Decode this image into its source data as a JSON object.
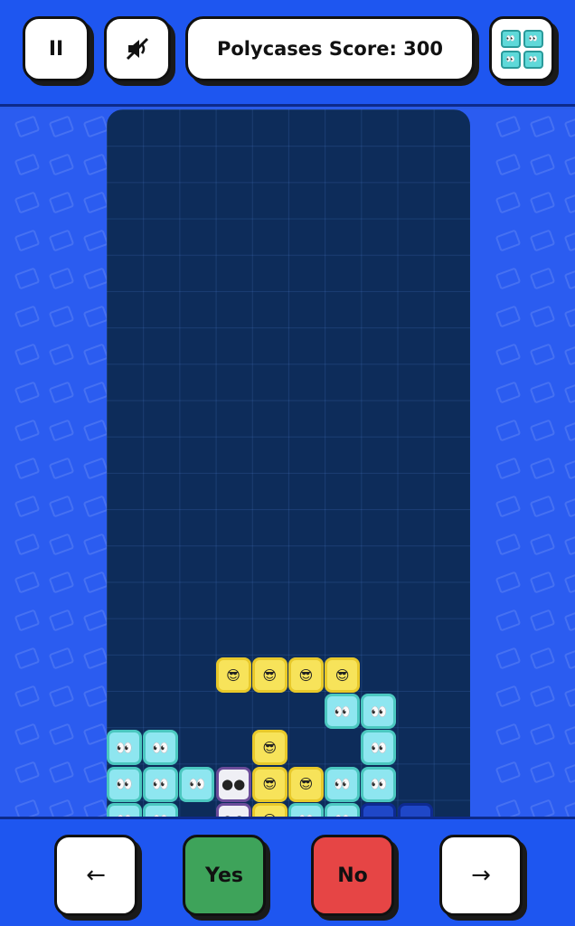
{
  "header": {
    "pause_label": "II",
    "score_text": "Polycases Score: 300",
    "menu_preview_glyph": "👀"
  },
  "board": {
    "columns": 10,
    "rows_visible": 20,
    "blocks": [
      {
        "col": 3,
        "row": 15,
        "color": "yellow",
        "face": "😎"
      },
      {
        "col": 4,
        "row": 15,
        "color": "yellow",
        "face": "😎"
      },
      {
        "col": 5,
        "row": 15,
        "color": "yellow",
        "face": "😎"
      },
      {
        "col": 6,
        "row": 15,
        "color": "yellow",
        "face": "😎"
      },
      {
        "col": 6,
        "row": 16,
        "color": "cyan",
        "face": "👀"
      },
      {
        "col": 7,
        "row": 16,
        "color": "cyan",
        "face": "👀"
      },
      {
        "col": 0,
        "row": 17,
        "color": "cyan",
        "face": "👀"
      },
      {
        "col": 1,
        "row": 17,
        "color": "cyan",
        "face": "👀"
      },
      {
        "col": 4,
        "row": 17,
        "color": "yellow",
        "face": "😎"
      },
      {
        "col": 7,
        "row": 17,
        "color": "cyan",
        "face": "👀"
      },
      {
        "col": 0,
        "row": 18,
        "color": "cyan",
        "face": "👀"
      },
      {
        "col": 1,
        "row": 18,
        "color": "cyan",
        "face": "👀"
      },
      {
        "col": 2,
        "row": 18,
        "color": "cyan",
        "face": "👀"
      },
      {
        "col": 3,
        "row": 18,
        "color": "white",
        "face": "●●"
      },
      {
        "col": 4,
        "row": 18,
        "color": "yellow",
        "face": "😎"
      },
      {
        "col": 5,
        "row": 18,
        "color": "yellow",
        "face": "😎"
      },
      {
        "col": 6,
        "row": 18,
        "color": "cyan",
        "face": "👀"
      },
      {
        "col": 7,
        "row": 18,
        "color": "cyan",
        "face": "👀"
      },
      {
        "col": 0,
        "row": 19,
        "color": "cyan",
        "face": "👀"
      },
      {
        "col": 1,
        "row": 19,
        "color": "cyan",
        "face": "👀"
      },
      {
        "col": 3,
        "row": 19,
        "color": "white",
        "face": "●●"
      },
      {
        "col": 4,
        "row": 19,
        "color": "yellow",
        "face": "😎"
      },
      {
        "col": 5,
        "row": 19,
        "color": "cyan",
        "face": "👀"
      },
      {
        "col": 6,
        "row": 19,
        "color": "cyan",
        "face": "👀"
      },
      {
        "col": 7,
        "row": 19,
        "color": "blue",
        "face": "▾▾"
      },
      {
        "col": 8,
        "row": 19,
        "color": "blue",
        "face": "▾▾"
      }
    ]
  },
  "controls": {
    "left_label": "←",
    "yes_label": "Yes",
    "no_label": "No",
    "right_label": "→"
  },
  "colors": {
    "background": "#2b5cf0",
    "board": "#0d2c5a",
    "yes": "#3ea35a",
    "no": "#e64545"
  }
}
